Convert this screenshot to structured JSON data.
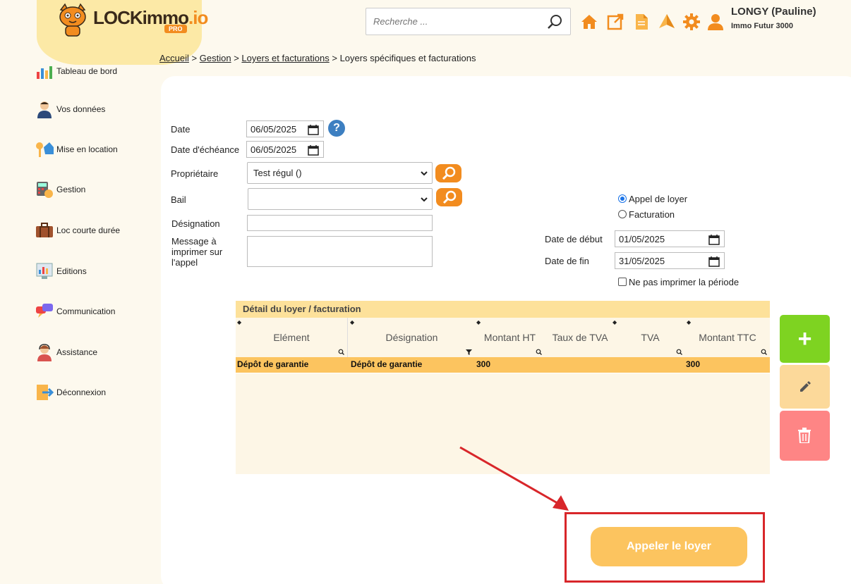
{
  "header": {
    "logo_main": "LOCKimmo",
    "logo_suffix": ".io",
    "logo_badge": "PRO",
    "search_placeholder": "Recherche ...",
    "user_name": "LONGY (Pauline)",
    "user_company": "Immo Futur 3000",
    "accent_color": "#f28c1f"
  },
  "sidebar": {
    "items": [
      {
        "label": "Tableau de bord",
        "icon": "dashboard-chart-icon"
      },
      {
        "label": "Vos données",
        "icon": "user-person-icon"
      },
      {
        "label": "Mise en location",
        "icon": "keys-house-icon"
      },
      {
        "label": "Gestion",
        "icon": "calculator-icon"
      },
      {
        "label": "Loc courte durée",
        "icon": "suitcase-icon"
      },
      {
        "label": "Editions",
        "icon": "report-icon"
      },
      {
        "label": "Communication",
        "icon": "chat-bubbles-icon"
      },
      {
        "label": "Assistance",
        "icon": "support-agent-icon"
      },
      {
        "label": "Déconnexion",
        "icon": "logout-door-icon"
      }
    ]
  },
  "breadcrumb": {
    "home": "Accueil",
    "sep": ">",
    "level1": "Gestion",
    "level2": "Loyers et facturations",
    "current": "Loyers spécifiques et facturations"
  },
  "form": {
    "date_label": "Date",
    "date_value": "06/05/2025",
    "due_label": "Date d'échéance",
    "due_value": "06/05/2025",
    "owner_label": "Propriétaire",
    "owner_value": "Test régul ()",
    "lease_label": "Bail",
    "lease_value": "",
    "designation_label": "Désignation",
    "message_label_1": "Message à",
    "message_label_2": "imprimer sur",
    "message_label_3": "l'appel",
    "help": "?",
    "radio_rent_call": "Appel de loyer",
    "radio_invoice": "Facturation",
    "start_label": "Date de début",
    "start_value": "01/05/2025",
    "end_label": "Date de fin",
    "end_value": "31/05/2025",
    "no_print_period": "Ne pas imprimer la période"
  },
  "table": {
    "title": "Détail du loyer / facturation",
    "columns": [
      "Elément",
      "Désignation",
      "Montant HT",
      "Taux de TVA",
      "TVA",
      "Montant TTC"
    ],
    "rows": [
      [
        "Dépôt de garantie",
        "Dépôt de garantie",
        "300",
        "",
        "",
        "300"
      ]
    ]
  },
  "actions": {
    "add": "+",
    "add_color": "#7ed321",
    "edit_color": "#fcd99a",
    "delete_color": "#fe8585",
    "main_button": "Appeler le loyer"
  }
}
